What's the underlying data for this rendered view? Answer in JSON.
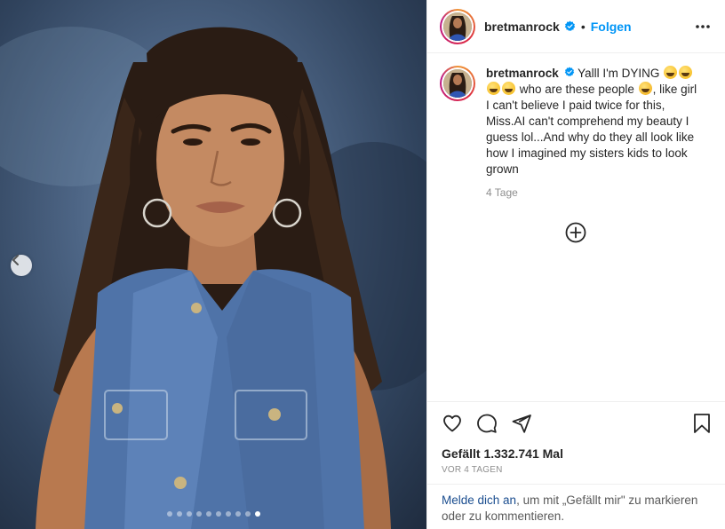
{
  "post": {
    "username": "bretmanrock",
    "separator": "•",
    "follow_label": "Folgen"
  },
  "caption": {
    "username": "bretmanrock",
    "text_part1": "Yalll I'm DYING",
    "text_part2": "who are these people",
    "text_part3": ", like girl I can't believe I paid twice for this, Miss.AI can't comprehend my beauty I guess lol...And why do they all look like how I imagined my sisters kids to look grown",
    "emojis": [
      "rofl-emoji",
      "grin-emoji",
      "grin-emoji",
      "grin-emoji",
      "loudly-crying-emoji"
    ],
    "time": "4 Tage"
  },
  "carousel": {
    "total_slides": 10,
    "active_index": 9
  },
  "actions": {
    "likes": "Gefällt 1.332.741 Mal",
    "date": "VOR 4 TAGEN"
  },
  "login_prompt": {
    "link": "Melde dich an",
    "rest": ", um mit „Gefällt mir\" zu markieren oder zu kommentieren."
  },
  "colors": {
    "accent_blue": "#0095f6",
    "verified_blue": "#0095f6",
    "text": "#262626",
    "muted": "#8e8e8e"
  }
}
